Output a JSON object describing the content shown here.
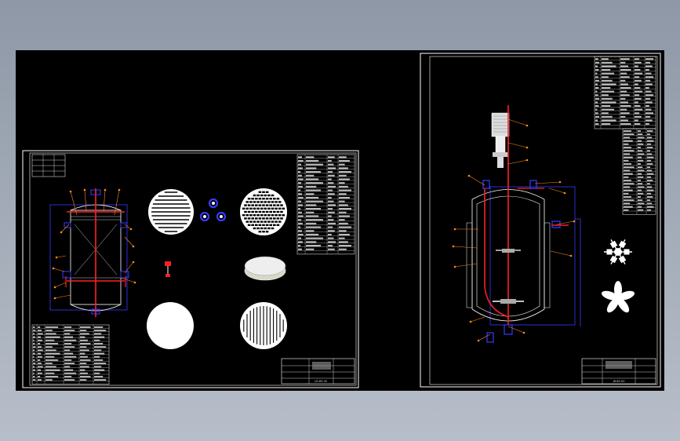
{
  "sheets": [
    {
      "title_block": {
        "drawing_number": "LD-89-00"
      }
    },
    {
      "title_block": {
        "drawing_number": "JB-89-00"
      }
    }
  ],
  "colors": {
    "background": "#000000",
    "frame_line": "#ffffff",
    "vessel_outline": "#3a3aff",
    "pipe": "#ff2020",
    "leader_orange": "#ff8a1a",
    "view_fill": "#ffffff"
  }
}
